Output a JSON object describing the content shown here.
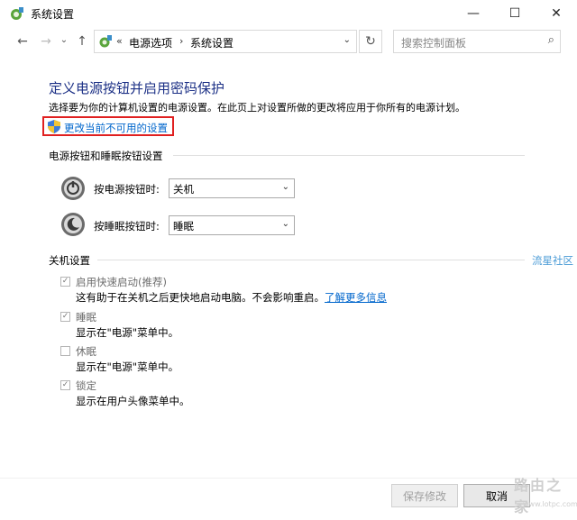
{
  "window": {
    "title": "系统设置"
  },
  "window_controls": {
    "minimize": "—",
    "maximize": "☐",
    "close": "✕"
  },
  "nav": {
    "back": "←",
    "forward": "→",
    "recent": "⌄",
    "up": "↑",
    "address": {
      "overflow": "«",
      "crumb1": "电源选项",
      "sep": "›",
      "crumb2": "系统设置",
      "dropdown": "⌄"
    },
    "refresh": "↻",
    "search_placeholder": "搜索控制面板",
    "search_glyph": "⌕"
  },
  "content": {
    "heading": "定义电源按钮并启用密码保护",
    "description": "选择要为你的计算机设置的电源设置。在此页上对设置所做的更改将应用于你所有的电源计划。",
    "uac_link": "更改当前不可用的设置",
    "power_section": {
      "title": "电源按钮和睡眠按钮设置",
      "rows": [
        {
          "label": "按电源按钮时:",
          "value": "关机"
        },
        {
          "label": "按睡眠按钮时:",
          "value": "睡眠"
        }
      ]
    },
    "shutdown_section": {
      "title": "关机设置",
      "items": [
        {
          "label": "启用快速启动(推荐)",
          "checked": true,
          "disabled": true,
          "desc": "这有助于在关机之后更快地启动电脑。不会影响重启。",
          "link": "了解更多信息"
        },
        {
          "label": "睡眠",
          "checked": true,
          "disabled": true,
          "desc": "显示在\"电源\"菜单中。"
        },
        {
          "label": "休眠",
          "checked": false,
          "disabled": true,
          "desc": "显示在\"电源\"菜单中。"
        },
        {
          "label": "锁定",
          "checked": true,
          "disabled": true,
          "desc": "显示在用户头像菜单中。"
        }
      ]
    },
    "side_watermark": "流星社区"
  },
  "footer": {
    "save": "保存修改",
    "cancel": "取消"
  },
  "watermark": {
    "logo": "路由之家",
    "url": "www.lotpc.com"
  },
  "colors": {
    "heading": "#1e3287",
    "link": "#0066cc",
    "highlight_box": "#e02020"
  }
}
